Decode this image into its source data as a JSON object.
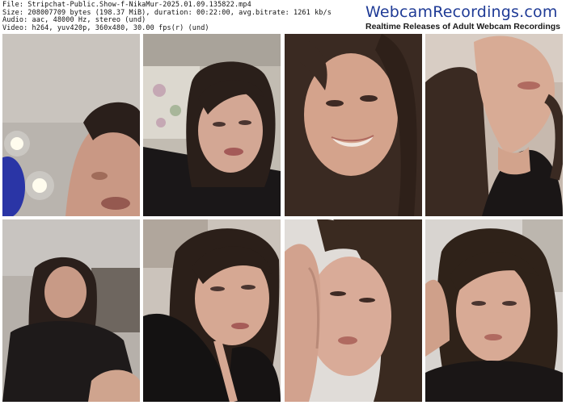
{
  "file_info": {
    "line1": "File: Stripchat-Public.Show-f-NikaMur-2025.01.09.135822.mp4",
    "line2": "Size: 208007709 bytes (198.37 MiB), duration: 00:22:00, avg.bitrate: 1261 kb/s",
    "line3": "Audio: aac, 48000 Hz, stereo (und)",
    "line4": "Video: h264, yuv420p, 360x480, 30.00 fps(r) (und)"
  },
  "brand": {
    "title": "WebcamRecordings.com",
    "tagline": "Realtime Releases of Adult Webcam Recordings"
  },
  "thumbnails": [
    {
      "id": 1,
      "scene": "ceiling-light-closeup"
    },
    {
      "id": 2,
      "scene": "lying-on-pillow"
    },
    {
      "id": 3,
      "scene": "smiling-closeup"
    },
    {
      "id": 4,
      "scene": "head-tilted-back"
    },
    {
      "id": 5,
      "scene": "blurred-sitting"
    },
    {
      "id": 6,
      "scene": "reclining-portrait"
    },
    {
      "id": 7,
      "scene": "hand-on-cheek"
    },
    {
      "id": 8,
      "scene": "profile-glance"
    }
  ]
}
